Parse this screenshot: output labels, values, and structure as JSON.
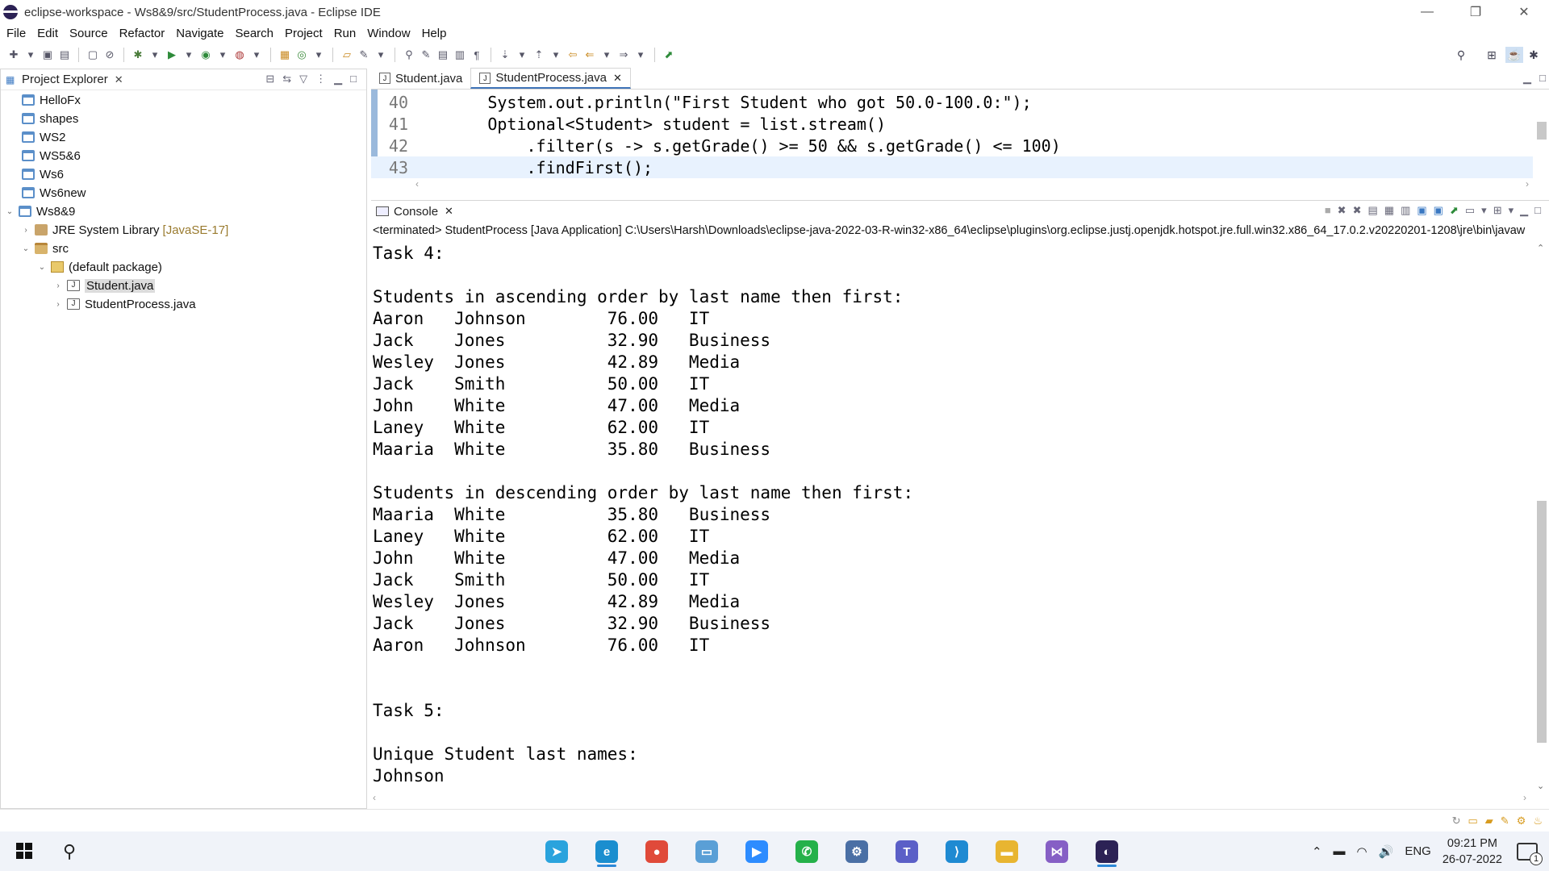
{
  "window": {
    "title": "eclipse-workspace - Ws8&9/src/StudentProcess.java - Eclipse IDE",
    "controls": [
      "—",
      "❐",
      "✕"
    ]
  },
  "menu": [
    "File",
    "Edit",
    "Source",
    "Refactor",
    "Navigate",
    "Search",
    "Project",
    "Run",
    "Window",
    "Help"
  ],
  "explorer": {
    "title": "Project Explorer",
    "items": [
      {
        "label": "HelloFx",
        "icon": "project-folder-icon"
      },
      {
        "label": "shapes",
        "icon": "project-folder-icon"
      },
      {
        "label": "WS2",
        "icon": "project-folder-icon"
      },
      {
        "label": "WS5&6",
        "icon": "project-folder-icon"
      },
      {
        "label": "Ws6",
        "icon": "project-folder-icon"
      },
      {
        "label": "Ws6new",
        "icon": "project-folder-icon"
      },
      {
        "label": "Ws8&9",
        "icon": "open-project-icon"
      },
      {
        "label": "JRE System Library",
        "decor": "[JavaSE-17]",
        "icon": "library-icon"
      },
      {
        "label": "src",
        "icon": "source-folder-icon"
      },
      {
        "label": "(default package)",
        "icon": "package-icon"
      },
      {
        "label": "Student.java",
        "icon": "java-file-icon"
      },
      {
        "label": "StudentProcess.java",
        "icon": "java-file-icon"
      }
    ]
  },
  "editor": {
    "tabs": [
      {
        "label": "Student.java"
      },
      {
        "label": "StudentProcess.java"
      }
    ],
    "lines": [
      {
        "num": "40",
        "text": "        System.out.println(\"First Student who got 50.0-100.0:\");"
      },
      {
        "num": "41",
        "text": "        Optional<Student> student = list.stream()"
      },
      {
        "num": "42",
        "text": "            .filter(s -> s.getGrade() >= 50 && s.getGrade() <= 100)"
      },
      {
        "num": "43",
        "text": "            .findFirst();"
      }
    ]
  },
  "console": {
    "tab_label": "Console",
    "status": "<terminated> StudentProcess [Java Application] C:\\Users\\Harsh\\Downloads\\eclipse-java-2022-03-R-win32-x86_64\\eclipse\\plugins\\org.eclipse.justj.openjdk.hotspot.jre.full.win32.x86_64_17.0.2.v20220201-1208\\jre\\bin\\javaw",
    "lines": [
      "Task 4:",
      "",
      "Students in ascending order by last name then first:",
      "Aaron   Johnson        76.00   IT",
      "Jack    Jones          32.90   Business",
      "Wesley  Jones          42.89   Media",
      "Jack    Smith          50.00   IT",
      "John    White          47.00   Media",
      "Laney   White          62.00   IT",
      "Maaria  White          35.80   Business",
      "",
      "Students in descending order by last name then first:",
      "Maaria  White          35.80   Business",
      "Laney   White          62.00   IT",
      "John    White          47.00   Media",
      "Jack    Smith          50.00   IT",
      "Wesley  Jones          42.89   Media",
      "Jack    Jones          32.90   Business",
      "Aaron   Johnson        76.00   IT",
      "",
      "",
      "Task 5:",
      "",
      "Unique Student last names:",
      "Johnson"
    ]
  },
  "taskbar": {
    "apps": [
      {
        "name": "telegram",
        "glyph": "➤",
        "color": "#2aa3dd"
      },
      {
        "name": "edge",
        "glyph": "e",
        "color": "#1b8ecf"
      },
      {
        "name": "chrome",
        "glyph": "●",
        "color": "#e04a3a"
      },
      {
        "name": "remote-desktop",
        "glyph": "▭",
        "color": "#5a9fd6"
      },
      {
        "name": "zoom",
        "glyph": "▶",
        "color": "#2d8cff"
      },
      {
        "name": "whatsapp",
        "glyph": "✆",
        "color": "#25b14a"
      },
      {
        "name": "network",
        "glyph": "⚙",
        "color": "#4a6fa5"
      },
      {
        "name": "teams",
        "glyph": "T",
        "color": "#5b5fc7"
      },
      {
        "name": "vscode",
        "glyph": "⟩",
        "color": "#1f8ad2"
      },
      {
        "name": "file-explorer",
        "glyph": "▬",
        "color": "#e8b531"
      },
      {
        "name": "visual-studio",
        "glyph": "⋈",
        "color": "#865fc5"
      },
      {
        "name": "eclipse",
        "glyph": "◐",
        "color": "#2c2255"
      }
    ],
    "language": "ENG",
    "time": "09:21 PM",
    "date": "26-07-2022",
    "notification_count": "1"
  }
}
